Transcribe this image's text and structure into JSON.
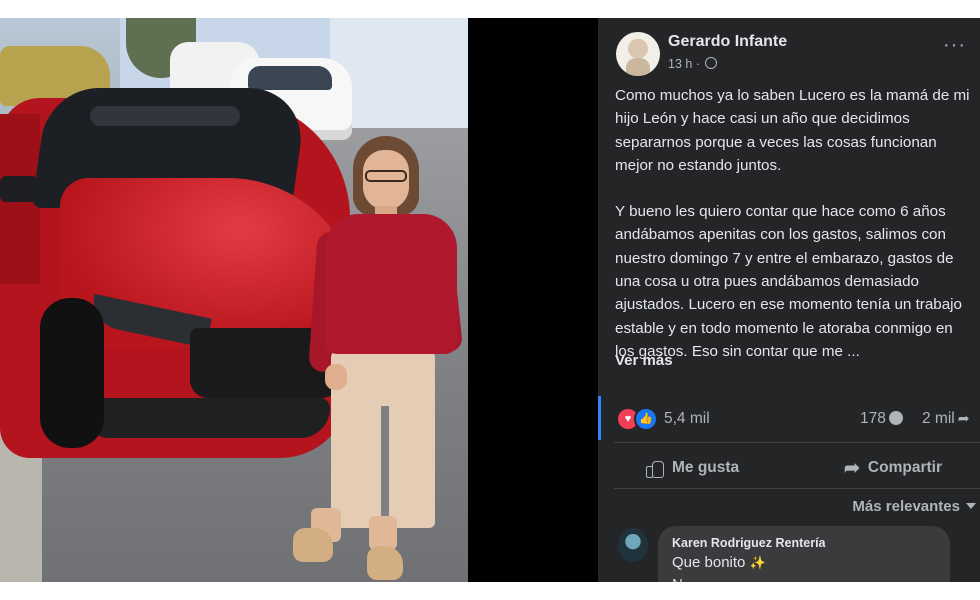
{
  "post": {
    "author": "Gerardo Infante",
    "time": "13 h ·",
    "paragraph1": "Como muchos ya lo saben Lucero es la mamá de mi hijo León y hace casi un año que decidimos separarnos porque a veces las cosas funcionan mejor no estando juntos.",
    "paragraph2": "Y bueno les quiero contar que hace como 6 años andábamos apenitas con los gastos, salimos con nuestro domingo 7 y entre el embarazo, gastos de una cosa u otra pues andábamos demasiado ajustados. Lucero en ese momento tenía un trabajo estable y en todo momento le atoraba conmigo en los gastos. Eso sin contar que me ...",
    "see_more": "Ver más"
  },
  "stats": {
    "reactions": "5,4 mil",
    "comments": "178",
    "shares": "2 mil"
  },
  "actions": {
    "like": "Me gusta",
    "share": "Compartir",
    "sort": "Más relevantes"
  },
  "comment": {
    "name": "Karen Rodriguez Rentería",
    "text": "Que bonito",
    "text2": "N"
  },
  "icons": {
    "more": "more-horizontal-icon",
    "privacy": "globe-icon",
    "love": "love-reaction-icon",
    "like": "like-reaction-icon",
    "comment": "comment-bubble-icon",
    "share": "share-arrow-icon",
    "sort": "caret-down-icon"
  },
  "colors": {
    "panel_bg": "#242526",
    "text": "#e4e6eb",
    "muted": "#b0b3b8",
    "like_blue": "#1877f2",
    "love_red": "#f33e58"
  }
}
